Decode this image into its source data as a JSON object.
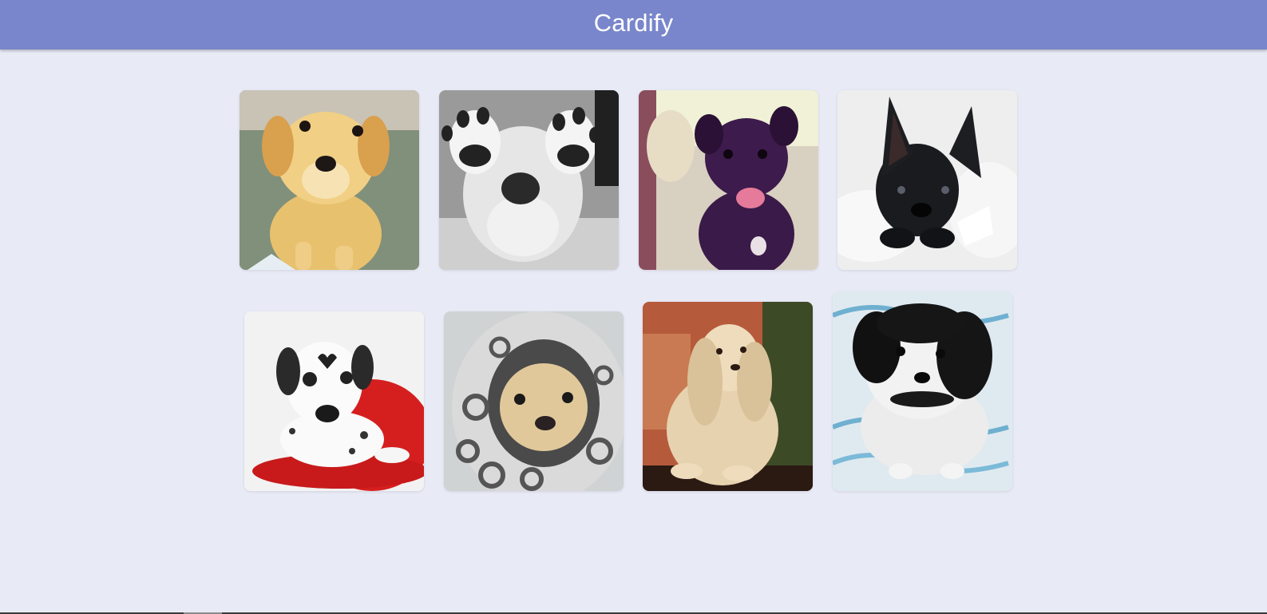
{
  "app": {
    "title": "Cardify"
  },
  "colors": {
    "app_bar": "#7986cb",
    "background": "#e8eaf6",
    "title_text": "#ffffff"
  },
  "cards": [
    {
      "subject": "golden-puppy"
    },
    {
      "subject": "bw-dog-paws"
    },
    {
      "subject": "black-pug"
    },
    {
      "subject": "french-bulldog"
    },
    {
      "subject": "dalmatian-puppy"
    },
    {
      "subject": "pug-in-hoodie"
    },
    {
      "subject": "fluffy-cream-dog"
    },
    {
      "subject": "shih-tzu-puppy"
    }
  ]
}
